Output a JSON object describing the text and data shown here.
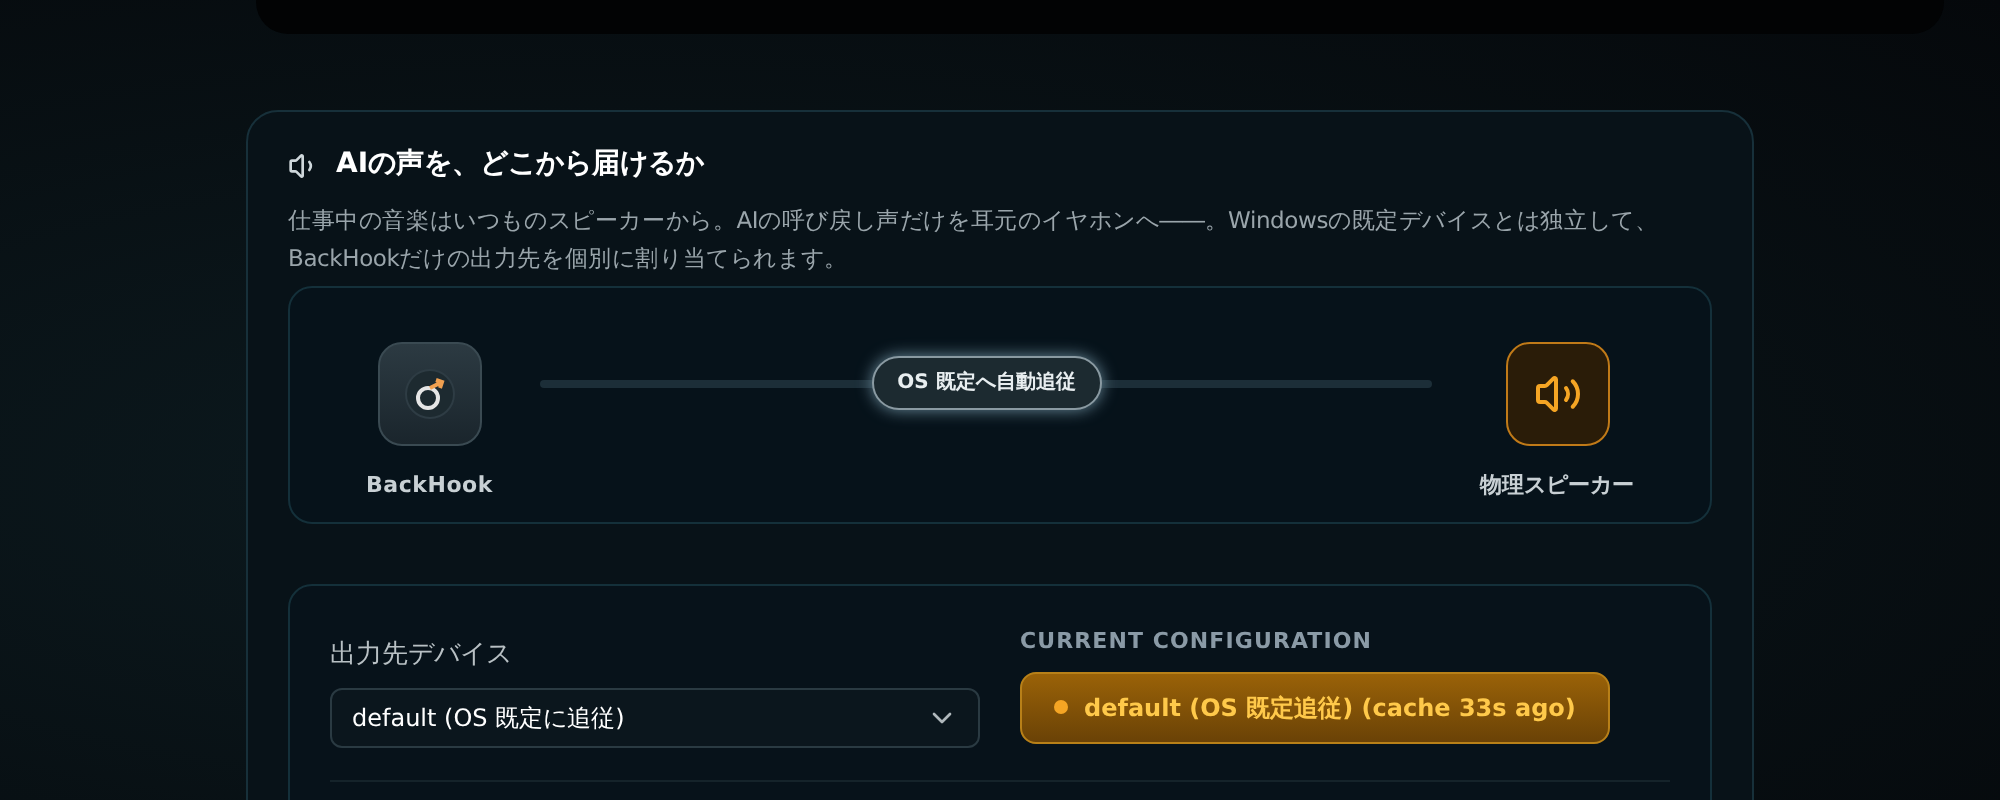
{
  "section": {
    "title": "AIの声を、どこから届けるか",
    "description": "仕事中の音楽はいつものスピーカーから。AIの呼び戻し声だけを耳元のイヤホンへ――。Windowsの既定デバイスとは独立して、BackHookだけの出力先を個別に割り当てられます。"
  },
  "routing": {
    "source": {
      "label": "BackHook"
    },
    "link": {
      "label": "OS 既定へ自動追従"
    },
    "target": {
      "label": "物理スピーカー",
      "active": true
    }
  },
  "config": {
    "device_label": "出力先デバイス",
    "device_value": "default (OS 既定に追従)",
    "current_label": "CURRENT CONFIGURATION",
    "current_status": {
      "text": "default (OS 既定追従) (cache 33s ago)",
      "color": "#f5a524"
    }
  }
}
